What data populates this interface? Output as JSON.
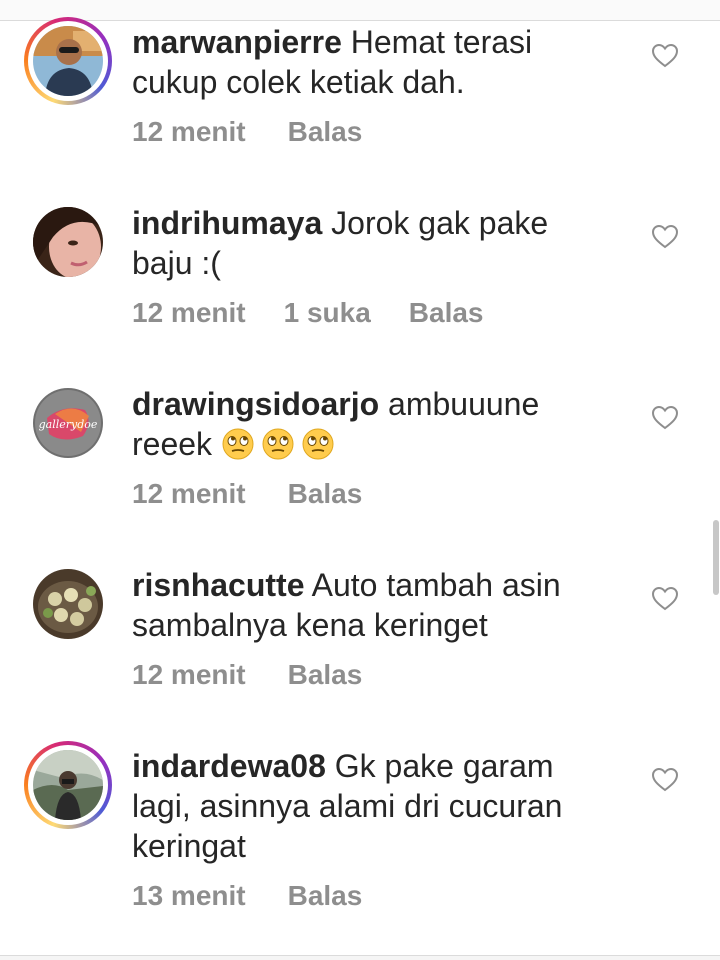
{
  "comments": [
    {
      "username": "marwanpierre",
      "text": "Hemat terasi cukup colek ketiak dah.",
      "time": "12 menit",
      "likes": "",
      "reply": "Balas",
      "avatar_icon": "avatar-man-sunglasses-photo",
      "story_ring": true
    },
    {
      "username": "indrihumaya",
      "text": "Jorok gak pake baju :(",
      "time": "12 menit",
      "likes": "1 suka",
      "reply": "Balas",
      "avatar_icon": "avatar-woman-face-photo",
      "story_ring": false
    },
    {
      "username": "drawingsidoarjo",
      "text": "ambuuune reeek",
      "emoji_count": 3,
      "emoji_icon": "face-with-rolling-eyes-emoji",
      "time": "12 menit",
      "likes": "",
      "reply": "Balas",
      "avatar_icon": "avatar-gallerydoe-logo",
      "avatar_logo_text": "gallerydoe",
      "story_ring": false
    },
    {
      "username": "risnhacutte",
      "text": "Auto tambah asin sambalnya kena keringet",
      "time": "12 menit",
      "likes": "",
      "reply": "Balas",
      "avatar_icon": "avatar-food-plate-photo",
      "story_ring": false
    },
    {
      "username": "indardewa08",
      "text": "Gk pake garam lagi, asinnya alami dri cucuran keringat",
      "time": "13 menit",
      "likes": "",
      "reply": "Balas",
      "avatar_icon": "avatar-man-outdoor-photo",
      "story_ring": true
    }
  ],
  "colors": {
    "text": "#262626",
    "meta": "#8e8e8e",
    "heart": "#8e8e8e",
    "background": "#ffffff"
  }
}
